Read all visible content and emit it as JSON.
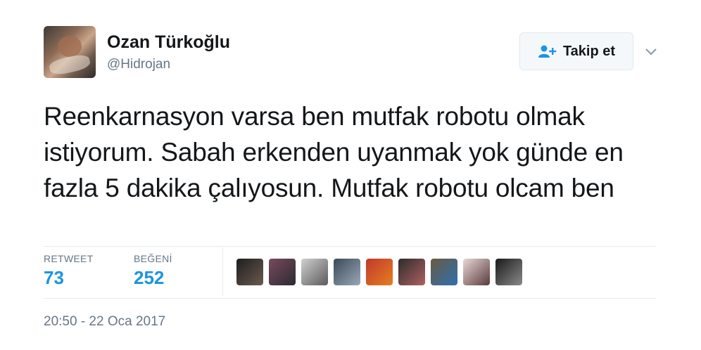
{
  "author": {
    "display_name": "Ozan Türkoğlu",
    "handle": "@Hidrojan"
  },
  "actions": {
    "follow_label": "Takip et",
    "follow_icon": "add-user-icon",
    "menu_icon": "chevron-down-icon"
  },
  "tweet": {
    "text": "Reenkarnasyon varsa ben mutfak robotu olmak istiyorum. Sabah erkenden uyanmak yok günde en fazla 5 dakika çalıyosun. Mutfak robotu olcam ben"
  },
  "stats": {
    "retweet_label": "RETWEET",
    "retweet_count": "73",
    "like_label": "BEĞENİ",
    "like_count": "252"
  },
  "likers": [
    {
      "colors": [
        "#1e1e1e",
        "#6b5a50"
      ]
    },
    {
      "colors": [
        "#7a4a5a",
        "#2a2a33"
      ]
    },
    {
      "colors": [
        "#d0d0d0",
        "#5a5a5a"
      ]
    },
    {
      "colors": [
        "#3a4a5a",
        "#9aa8b5"
      ]
    },
    {
      "colors": [
        "#c0392b",
        "#e67e22"
      ]
    },
    {
      "colors": [
        "#2c2c2c",
        "#b06060"
      ]
    },
    {
      "colors": [
        "#6a5a40",
        "#2f6fb0"
      ]
    },
    {
      "colors": [
        "#e8d8d8",
        "#5a3a3a"
      ]
    },
    {
      "colors": [
        "#1a1a1a",
        "#8a8a8a"
      ]
    }
  ],
  "timestamp": "20:50 - 22 Oca 2017",
  "colors": {
    "accent": "#1b95e0",
    "muted": "#657786",
    "text": "#14171a"
  }
}
